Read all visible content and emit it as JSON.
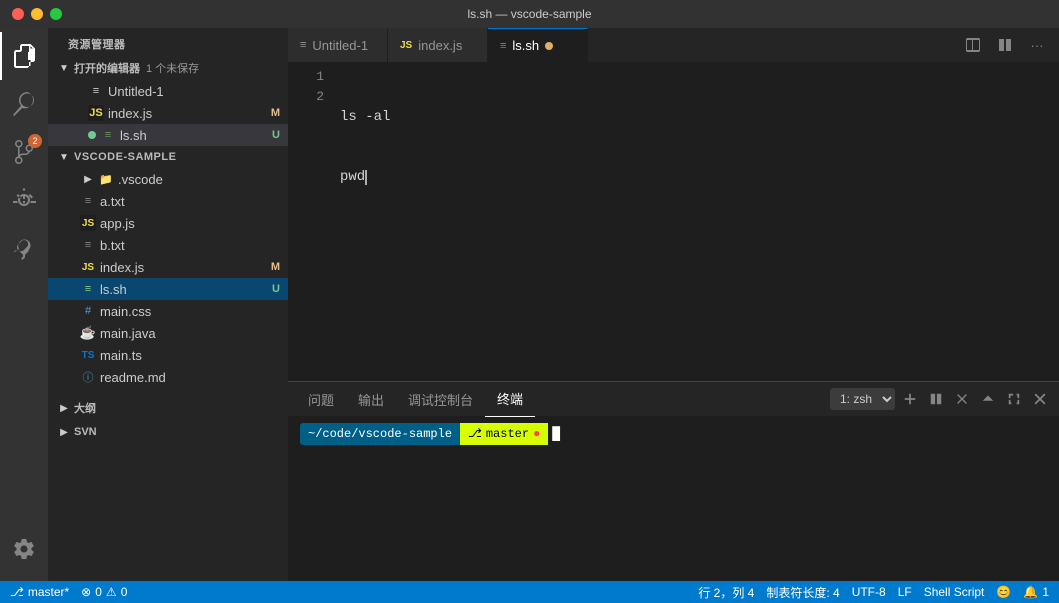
{
  "titlebar": {
    "title": "ls.sh — vscode-sample"
  },
  "activity_bar": {
    "icons": [
      {
        "name": "explorer",
        "label": "Explorer",
        "active": true,
        "badge": null
      },
      {
        "name": "search",
        "label": "Search",
        "active": false,
        "badge": null
      },
      {
        "name": "source-control",
        "label": "Source Control",
        "active": false,
        "badge": "2"
      },
      {
        "name": "run-debug",
        "label": "Run and Debug",
        "active": false,
        "badge": null
      },
      {
        "name": "extensions",
        "label": "Extensions",
        "active": false,
        "badge": null
      }
    ],
    "bottom_icons": [
      {
        "name": "settings",
        "label": "Settings"
      }
    ]
  },
  "sidebar": {
    "header": "资源管理器",
    "open_editors": {
      "title": "打开的编辑器",
      "badge": "1 个未保存",
      "files": [
        {
          "name": "Untitled-1",
          "icon": "file",
          "modified": false
        },
        {
          "name": "index.js",
          "icon": "js",
          "badge": "M"
        },
        {
          "name": "ls.sh",
          "icon": "sh",
          "dot": true,
          "badge": "U",
          "active": true
        }
      ]
    },
    "project": {
      "name": "VSCODE-SAMPLE",
      "items": [
        {
          "name": ".vscode",
          "type": "folder",
          "collapsed": true,
          "indent": 1
        },
        {
          "name": "a.txt",
          "type": "file",
          "icon": "txt",
          "indent": 1
        },
        {
          "name": "app.js",
          "type": "file",
          "icon": "js",
          "indent": 1
        },
        {
          "name": "b.txt",
          "type": "file",
          "icon": "txt",
          "indent": 1
        },
        {
          "name": "index.js",
          "type": "file",
          "icon": "js",
          "badge": "M",
          "indent": 1
        },
        {
          "name": "ls.sh",
          "type": "file",
          "icon": "sh",
          "badge": "U",
          "active": true,
          "indent": 1
        },
        {
          "name": "main.css",
          "type": "file",
          "icon": "css",
          "indent": 1
        },
        {
          "name": "main.java",
          "type": "file",
          "icon": "java",
          "indent": 1
        },
        {
          "name": "main.ts",
          "type": "file",
          "icon": "ts",
          "indent": 1
        },
        {
          "name": "readme.md",
          "type": "file",
          "icon": "md",
          "indent": 1
        }
      ]
    },
    "outline": {
      "title": "大纲"
    },
    "svn": {
      "title": "SVN"
    }
  },
  "tabs": [
    {
      "name": "Untitled-1",
      "icon": "file",
      "active": false,
      "modified_dot": false
    },
    {
      "name": "index.js",
      "icon": "js",
      "active": false,
      "modified_dot": false
    },
    {
      "name": "ls.sh",
      "icon": "sh",
      "active": true,
      "modified_dot": true
    }
  ],
  "editor": {
    "lines": [
      {
        "num": 1,
        "content": "ls -al"
      },
      {
        "num": 2,
        "content": "pwd"
      }
    ]
  },
  "panel": {
    "tabs": [
      {
        "label": "问题",
        "active": false
      },
      {
        "label": "输出",
        "active": false
      },
      {
        "label": "调试控制台",
        "active": false
      },
      {
        "label": "终端",
        "active": true
      }
    ],
    "terminal_selector": "1: zsh",
    "prompt": {
      "path": "~/code/vscode-sample",
      "branch": "master"
    }
  },
  "statusbar": {
    "branch": "master*",
    "errors": "0",
    "warnings": "0",
    "position": "行 2，列 4",
    "tab_size": "制表符长度: 4",
    "encoding": "UTF-8",
    "line_ending": "LF",
    "language": "Shell Script",
    "smiley": "😊",
    "notifications": "1"
  }
}
